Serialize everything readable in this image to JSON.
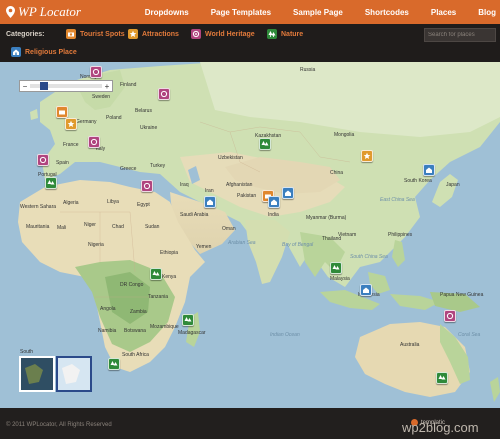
{
  "header": {
    "logo_text": "WP Locator",
    "nav": [
      {
        "label": "Dropdowns",
        "name": "nav-dropdowns"
      },
      {
        "label": "Page Templates",
        "name": "nav-page-templates"
      },
      {
        "label": "Sample Page",
        "name": "nav-sample-page"
      },
      {
        "label": "Shortcodes",
        "name": "nav-shortcodes"
      },
      {
        "label": "Places",
        "name": "nav-places"
      },
      {
        "label": "Blog",
        "name": "nav-blog"
      }
    ]
  },
  "categories": {
    "label": "Categories:",
    "items": [
      {
        "label": "Tourist Spots",
        "color": "#e0872e",
        "icon": "camera-icon"
      },
      {
        "label": "Attractions",
        "color": "#e09a2e",
        "icon": "star-icon"
      },
      {
        "label": "World Heritage",
        "color": "#b0457f",
        "icon": "heritage-icon"
      },
      {
        "label": "Nature",
        "color": "#2f8a3a",
        "icon": "tree-icon"
      },
      {
        "label": "Religious Place",
        "color": "#3b7fbf",
        "icon": "church-icon"
      }
    ],
    "search_placeholder": "Search for places"
  },
  "map": {
    "places": [
      {
        "label": "Russia"
      },
      {
        "label": "Kazakhstan"
      },
      {
        "label": "Mongolia"
      },
      {
        "label": "China"
      },
      {
        "label": "India"
      },
      {
        "label": "Iran"
      },
      {
        "label": "Afghanistan"
      },
      {
        "label": "Pakistan"
      },
      {
        "label": "Uzbekistan"
      },
      {
        "label": "Turkey"
      },
      {
        "label": "Ukraine"
      },
      {
        "label": "Poland"
      },
      {
        "label": "Germany"
      },
      {
        "label": "France"
      },
      {
        "label": "Spain"
      },
      {
        "label": "Portugal"
      },
      {
        "label": "Sweden"
      },
      {
        "label": "Finland"
      },
      {
        "label": "Norway"
      },
      {
        "label": "Belarus"
      },
      {
        "label": "Greece"
      },
      {
        "label": "Italy"
      },
      {
        "label": "Egypt"
      },
      {
        "label": "Libya"
      },
      {
        "label": "Algeria"
      },
      {
        "label": "Mali"
      },
      {
        "label": "Niger"
      },
      {
        "label": "Chad"
      },
      {
        "label": "Sudan"
      },
      {
        "label": "Nigeria"
      },
      {
        "label": "Ethiopia"
      },
      {
        "label": "DR Congo"
      },
      {
        "label": "Kenya"
      },
      {
        "label": "Tanzania"
      },
      {
        "label": "Angola"
      },
      {
        "label": "Zambia"
      },
      {
        "label": "Namibia"
      },
      {
        "label": "Botswana"
      },
      {
        "label": "Mozambique"
      },
      {
        "label": "South Africa"
      },
      {
        "label": "Madagascar"
      },
      {
        "label": "Mauritania"
      },
      {
        "label": "Saudi Arabia"
      },
      {
        "label": "Yemen"
      },
      {
        "label": "Iraq"
      },
      {
        "label": "Oman"
      },
      {
        "label": "Myanmar (Burma)"
      },
      {
        "label": "Thailand"
      },
      {
        "label": "Vietnam"
      },
      {
        "label": "Philippines"
      },
      {
        "label": "Malaysia"
      },
      {
        "label": "Indonesia"
      },
      {
        "label": "Japan"
      },
      {
        "label": "South Korea"
      },
      {
        "label": "Papua New Guinea"
      },
      {
        "label": "Australia"
      },
      {
        "label": "Western Sahara"
      }
    ],
    "seas": [
      {
        "label": "Arabian Sea"
      },
      {
        "label": "Bay of Bengal"
      },
      {
        "label": "South China Sea"
      },
      {
        "label": "East China Sea"
      },
      {
        "label": "Coral Sea"
      },
      {
        "label": "Indian Ocean"
      }
    ],
    "zoom": {
      "minus": "−",
      "plus": "+"
    },
    "thumbs": [
      {
        "label": "South"
      }
    ]
  },
  "footer": {
    "copyright": "© 2011 WPLocator, All Rights Reserved",
    "brand": "templatic",
    "watermark": "wp2blog.com"
  }
}
